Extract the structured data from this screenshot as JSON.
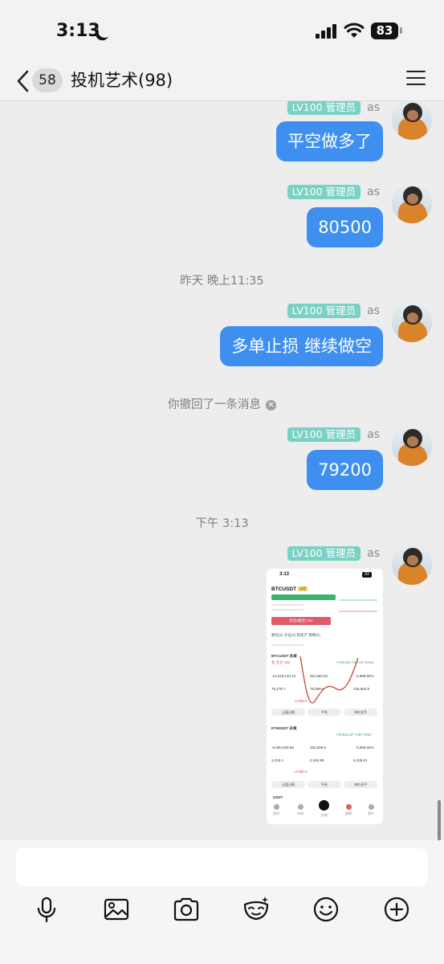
{
  "status_bar": {
    "time": "3:13",
    "battery": "83"
  },
  "header": {
    "unread_count": "58",
    "title": "投机艺术(98)"
  },
  "messages": [
    {
      "badge": "LV100 管理员",
      "sender": "as",
      "text": "平空做多了"
    },
    {
      "badge": "LV100 管理员",
      "sender": "as",
      "text": "80500"
    },
    {
      "badge": "LV100 管理员",
      "sender": "as",
      "text": "多单止损 继续做空"
    },
    {
      "badge": "LV100 管理员",
      "sender": "as",
      "text": "79200"
    },
    {
      "badge": "LV100 管理员",
      "sender": "as",
      "text": ""
    }
  ],
  "time_separators": [
    "昨天 晚上11:35",
    "下午 3:13"
  ],
  "recall_notice": "你撤回了一条消息",
  "shared_screenshot": {
    "time": "3:13",
    "battery": "83",
    "pair": "BTCUSDT",
    "tag": "永续",
    "sell_button": "卖出(做空) 20x",
    "tabs": "委托(2)   仓位(2) 和资产   策略(0)",
    "positions": [
      {
        "symbol": "BTCUSDT 永续",
        "side": "多 全仓 20x",
        "pnl": "+178,631.73 (+27.51%)",
        "size": "-12,233,140.12",
        "margin": "611,684.62",
        "ratio": "6,958.82%",
        "entry": "79,178.7",
        "mark": "78,089.6",
        "liq": "135,904.8",
        "funding": "-2,656.5"
      },
      {
        "symbol": "ETHUSDT 永续",
        "pnl": "+78,811.87 (+30.74%)",
        "size": "-5,050,463.58",
        "margin": "252,629.6",
        "ratio": "6,958.82%",
        "entry": "2,219.1",
        "mark": "2,184.99",
        "liq": "6,105.01",
        "funding": "-2,655.5"
      }
    ],
    "buttons": [
      "止盈止损",
      "平仓",
      "市价全平"
    ],
    "bottom_tabs": [
      "首页",
      "市场",
      "交易",
      "跟单",
      "资产"
    ],
    "asset": "USDT"
  },
  "input": {
    "placeholder": ""
  },
  "toolbar": [
    "microphone-icon",
    "image-icon",
    "camera-icon",
    "mask-icon",
    "emoji-icon",
    "plus-icon"
  ]
}
